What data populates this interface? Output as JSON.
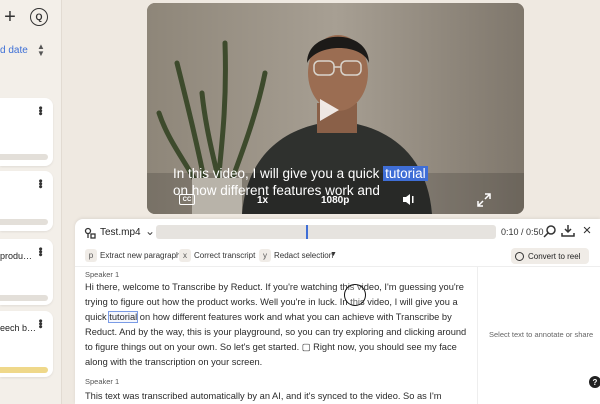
{
  "colors": {
    "accent": "#3f6ed6",
    "background": "#efe9e1"
  },
  "sidebar": {
    "plus_icon": "plus-icon",
    "chat_icon": "search-chat-icon",
    "sort_label": "d date",
    "cards": [
      {
        "title": "",
        "progress_bar": "gray"
      },
      {
        "title": "",
        "progress_bar": "gray"
      },
      {
        "title": "produ…",
        "progress_bar": "gray"
      },
      {
        "title": "eech b…",
        "progress_bar": "yellow"
      }
    ]
  },
  "video": {
    "caption_line1_pre": "In this video, I will give you a quick ",
    "caption_line1_highlight": "tutorial",
    "caption_line2": "on how different features work and",
    "cc_label": "CC",
    "speed": "1x",
    "quality": "1080p"
  },
  "editor": {
    "filename": "Test.mp4",
    "timecode": "0:10 / 0:50",
    "playback_progress": 0.2,
    "toolbar": {
      "extract_key": "p",
      "extract_label": "Extract new paragraph",
      "correct_key": "x",
      "correct_label": "Correct transcript",
      "redact_key": "y",
      "redact_label": "Redact selection",
      "convert_label": "Convert to reel"
    },
    "transcript": [
      {
        "speaker": "Speaker 1",
        "text_pre": "Hi there, welcome to Transcribe by Reduct. If you're watching this video, I'm guessing you're trying to figure out how the product works. Well you're in luck. In this video, I will give you a quick ",
        "text_sel": "tutorial",
        "text_post": " on how different features work and what you can achieve with Transcribe by Reduct. And by the way, this is your playground, so you can try exploring and clicking around to figure things out on your own. So let's get started. ▢ Right now, you should see my face along with the transcription on your screen."
      },
      {
        "speaker": "Speaker 1",
        "text_pre": "This text was transcribed automatically by an AI, and it's synced to the video. So as I'm speaking,",
        "text_sel": "",
        "text_post": ""
      }
    ],
    "side_hint": "Select text to annotate or share"
  }
}
